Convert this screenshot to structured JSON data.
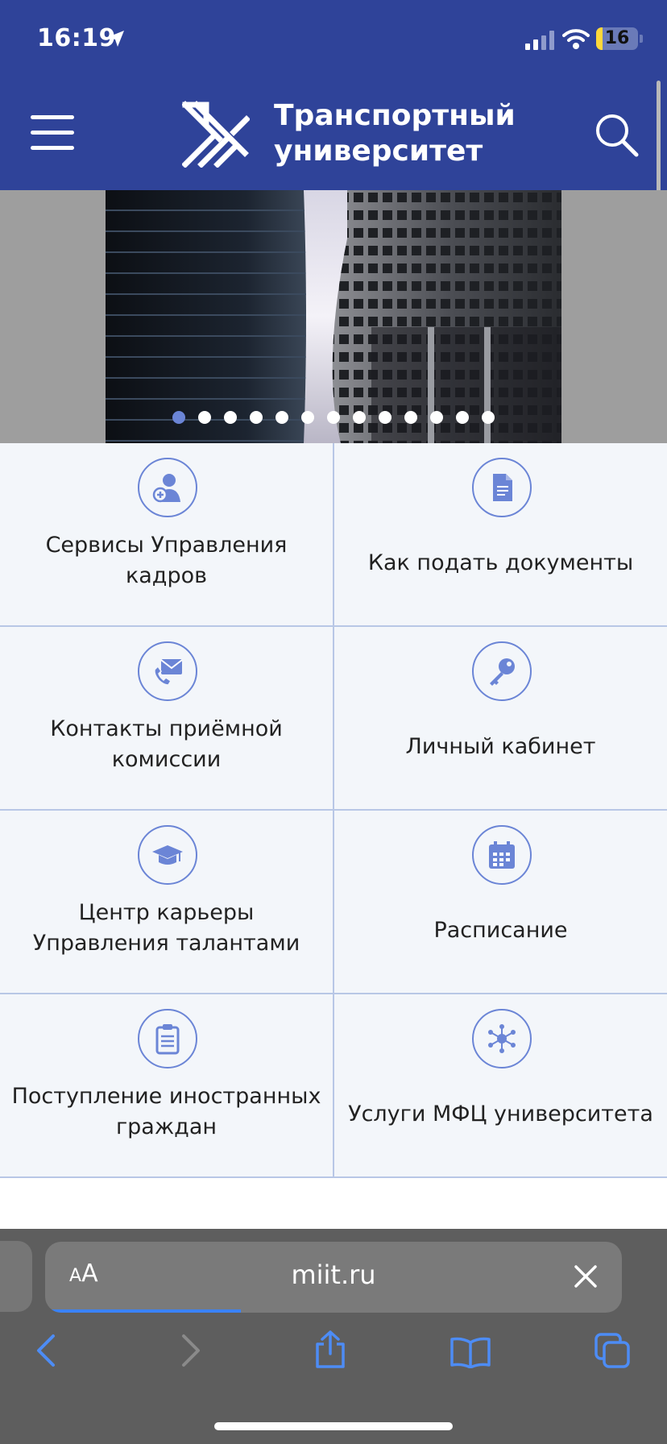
{
  "status_bar": {
    "time": "16:19",
    "battery": "16"
  },
  "header": {
    "brand_line1": "Транспортный",
    "brand_line2": "университет"
  },
  "carousel": {
    "dots": 13,
    "active_index": 0
  },
  "tiles": [
    {
      "label": "Сервисы Управления кадров",
      "icon": "user-plus-icon"
    },
    {
      "label": "Как подать документы",
      "icon": "document-icon"
    },
    {
      "label": "Контакты приёмной комиссии",
      "icon": "phone-mail-icon"
    },
    {
      "label": "Личный кабинет",
      "icon": "key-icon"
    },
    {
      "label": "Центр карьеры Управления талантами",
      "icon": "graduation-cap-icon"
    },
    {
      "label": "Расписание",
      "icon": "calendar-icon"
    },
    {
      "label": "Поступление иностранных граждан",
      "icon": "clipboard-icon"
    },
    {
      "label": "Услуги МФЦ университета",
      "icon": "network-icon"
    }
  ],
  "browser": {
    "text_size_label": "AA",
    "url": "miit.ru",
    "load_progress": 0.34
  },
  "colors": {
    "header": "#2f4399",
    "accent": "#6b85d6",
    "tile_bg": "#f3f6fa"
  }
}
